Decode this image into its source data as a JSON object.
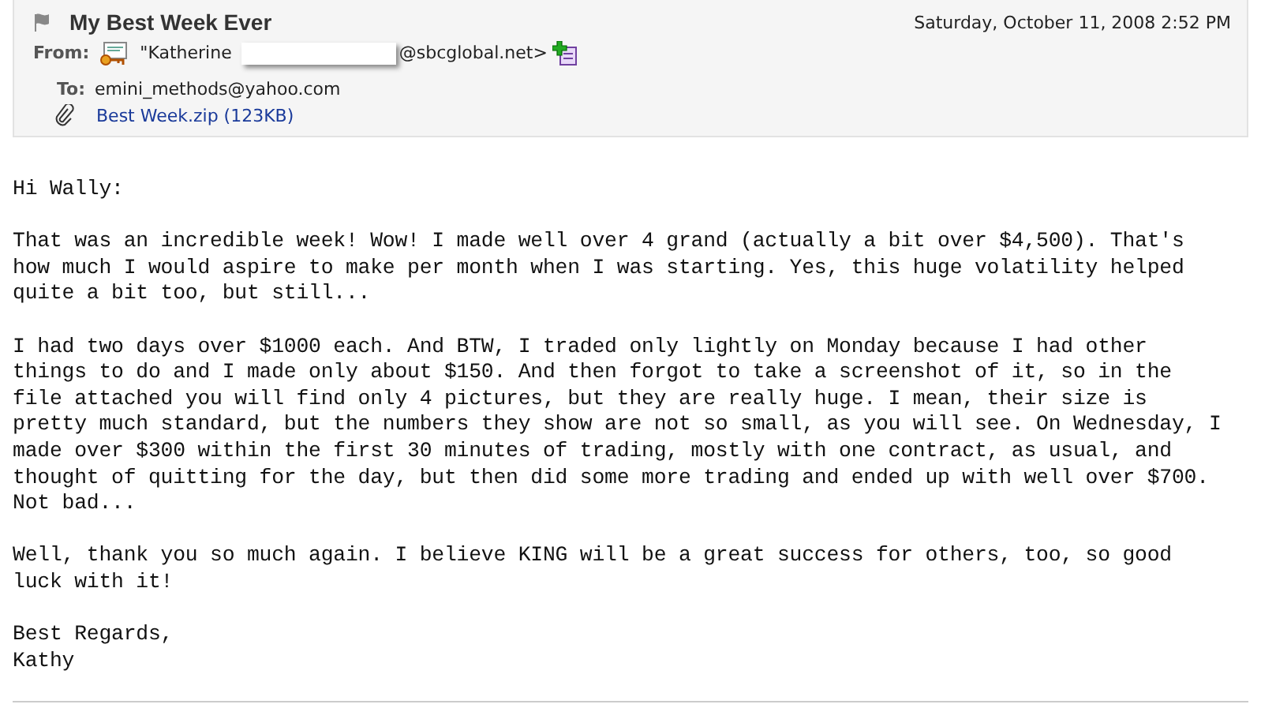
{
  "header": {
    "subject": "My Best Week Ever",
    "date": "Saturday, October 11, 2008 2:52 PM",
    "from_label": "From:",
    "from_start": "\"Katherine",
    "from_end": "@sbcglobal.net>",
    "to_label": "To:",
    "to": "emini_methods@yahoo.com",
    "attachment": "Best Week.zip (123KB)"
  },
  "body": [
    [
      "Hi Wally:"
    ],
    [
      "That was an incredible week! Wow! I made well over 4 grand (actually a bit over $4,500). That's",
      "how much I would aspire to make per month when I was starting. Yes, this huge volatility helped",
      "quite a bit too, but still..."
    ],
    [
      "I had two days over $1000 each. And BTW, I traded only lightly on Monday because I had other",
      "things to do and I made only about $150. And then forgot to take a screenshot of it, so in the",
      "file attached you will find only 4 pictures, but they are really huge. I mean, their size is",
      "pretty much standard, but the numbers they show are not so small, as you will see. On Wednesday, I",
      "made over $300 within the first 30 minutes of trading, mostly with one contract, as usual, and",
      "thought of quitting for the day, but then did some more trading and ended up with well over $700.",
      "Not bad..."
    ],
    [
      "Well, thank you so much again. I believe KING will be a great success for others, too, so good",
      "luck with it!"
    ],
    [
      "Best Regards,",
      "Kathy"
    ]
  ]
}
